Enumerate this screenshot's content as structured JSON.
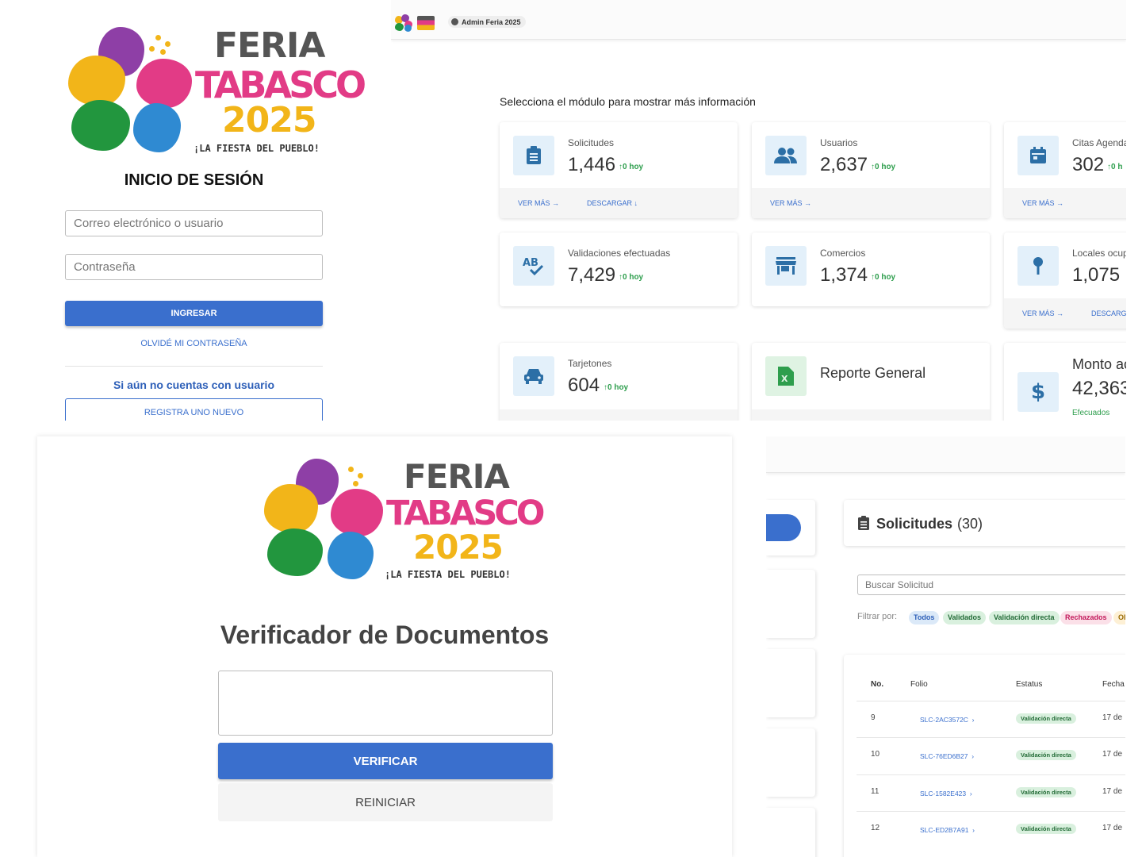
{
  "logo": {
    "line1": "FERIA",
    "line2": "TABASCO",
    "line3": "2025",
    "tagline": "¡LA FIESTA DEL PUEBLO!"
  },
  "login": {
    "title": "INICIO DE SESIÓN",
    "user_placeholder": "Correo electrónico o usuario",
    "password_placeholder": "Contraseña",
    "submit_label": "INGRESAR",
    "forgot_label": "OLVIDÉ MI CONTRASEÑA",
    "no_account_text": "Si aún no cuentas con usuario",
    "register_label": "REGISTRA UNO NUEVO"
  },
  "dashboard": {
    "admin_chip": "Admin Feria 2025",
    "heading": "Selecciona el módulo para mostrar más información",
    "ver_mas": "VER MÁS",
    "descargar": "DESCARGAR",
    "descarga_cut": "DESCARGA",
    "cards": {
      "solicitudes": {
        "label": "Solicitudes",
        "value": "1,446",
        "delta": "0 hoy",
        "icon": "clipboard-icon"
      },
      "usuarios": {
        "label": "Usuarios",
        "value": "2,637",
        "delta": "0 hoy",
        "icon": "users-icon"
      },
      "citas": {
        "label": "Citas Agenda",
        "value": "302",
        "delta": "0 h",
        "icon": "calendar-icon"
      },
      "validaciones": {
        "label": "Validaciones efectuadas",
        "value": "7,429",
        "delta": "0 hoy",
        "icon": "spellcheck-icon"
      },
      "comercios": {
        "label": "Comercios",
        "value": "1,374",
        "delta": "0 hoy",
        "icon": "store-icon"
      },
      "locales": {
        "label": "Locales ocup",
        "value": "1,075",
        "icon": "pin-icon"
      },
      "tarjetones": {
        "label": "Tarjetones",
        "value": "604",
        "delta": "0 hoy",
        "icon": "car-icon"
      },
      "reporte": {
        "label": "Reporte General",
        "icon": "excel-icon"
      },
      "monto": {
        "label": "Monto ac",
        "value": "42,363",
        "sub": "Efecuados",
        "icon": "dollar-icon"
      }
    }
  },
  "verificador": {
    "title": "Verificador de Documentos",
    "verify_label": "VERIFICAR",
    "reset_label": "REINICIAR"
  },
  "solicitudes": {
    "title": "Solicitudes",
    "count": "(30)",
    "search_placeholder": "Buscar Solicitud",
    "filter_label": "Filtrar por:",
    "filters": [
      "Todos",
      "Validados",
      "Validación directa",
      "Rechazados",
      "Ol"
    ],
    "columns": [
      "No.",
      "Folio",
      "Estatus",
      "Fecha"
    ],
    "rows": [
      {
        "no": "9",
        "folio": "SLC-2AC3572C",
        "status": "Validación directa",
        "fecha": "17 de"
      },
      {
        "no": "10",
        "folio": "SLC-76ED6B27",
        "status": "Validación directa",
        "fecha": "17 de"
      },
      {
        "no": "11",
        "folio": "SLC-1582E423",
        "status": "Validación directa",
        "fecha": "17 de"
      },
      {
        "no": "12",
        "folio": "SLC-ED2B7A91",
        "status": "Validación directa",
        "fecha": "17 de"
      }
    ]
  }
}
